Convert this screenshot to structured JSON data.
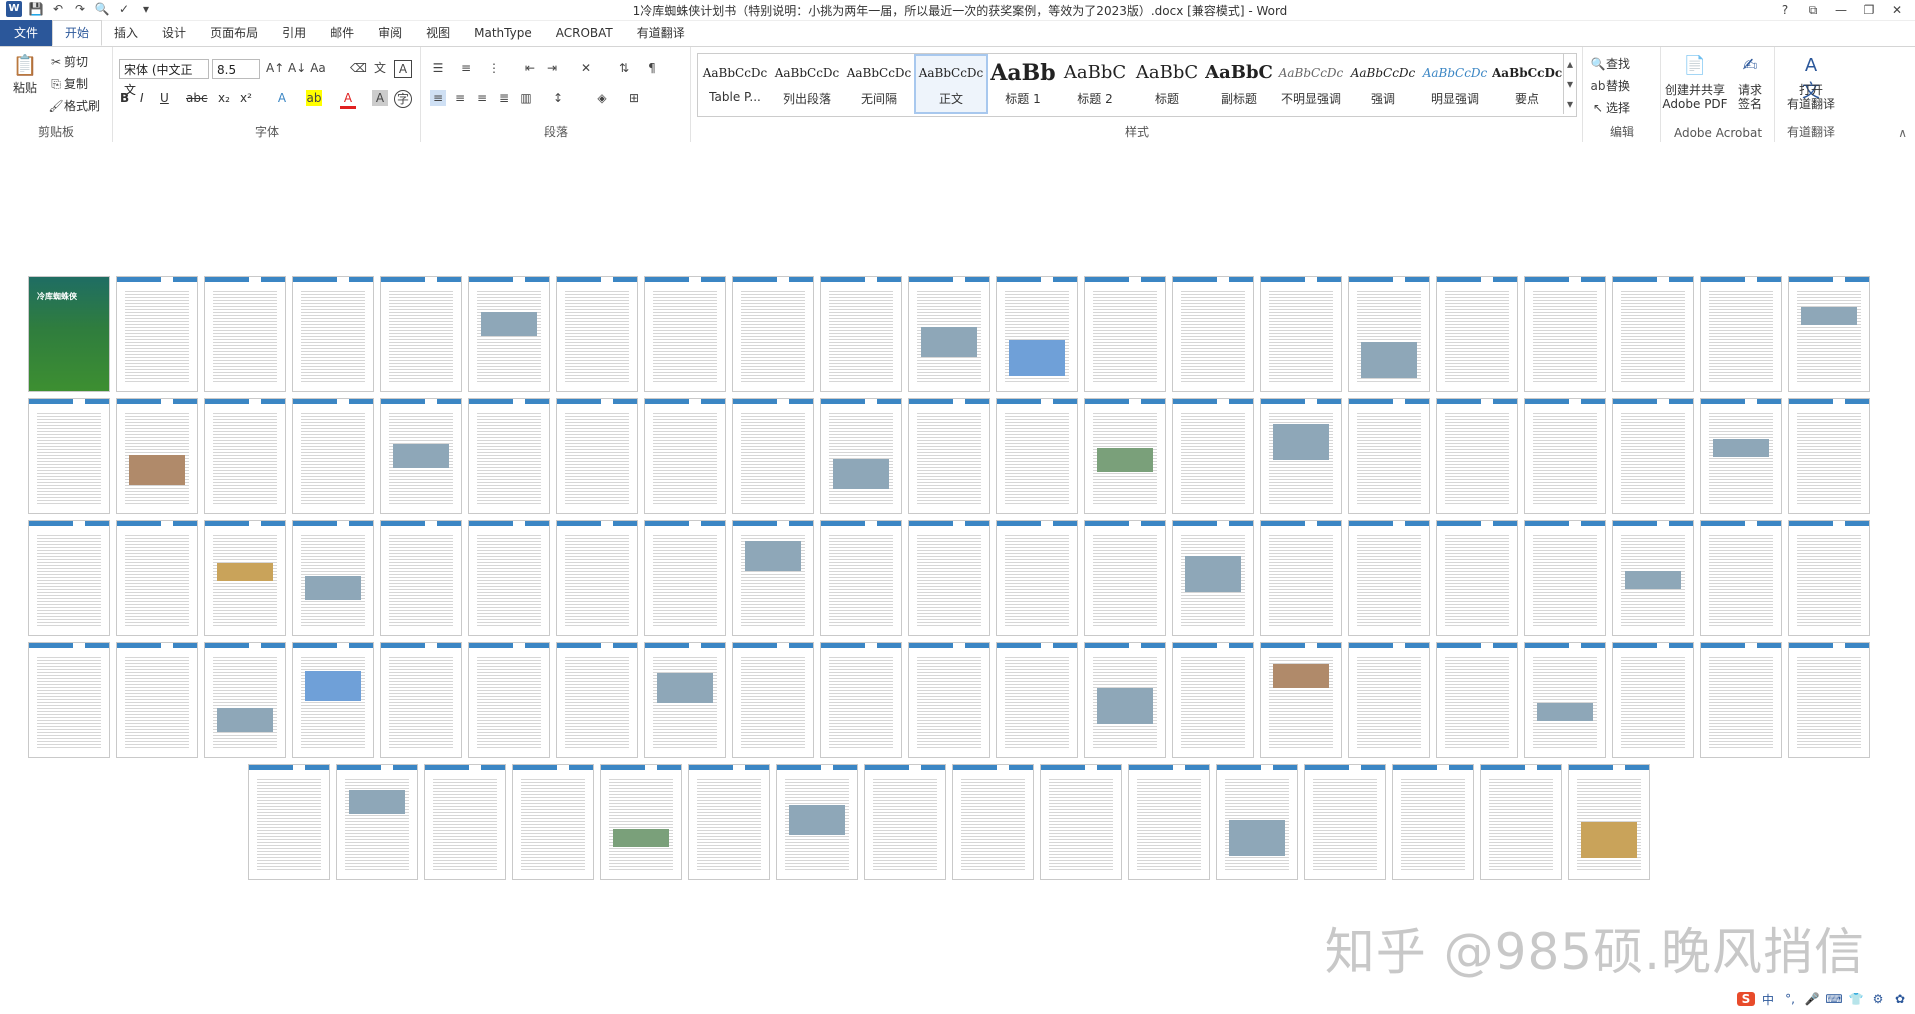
{
  "window": {
    "title": "1冷库蜘蛛侠计划书（特别说明：小挑为两年一届，所以最近一次的获奖案例，等效为了2023版）.docx [兼容模式] - Word",
    "controls": [
      "?",
      "⧉",
      "—",
      "❐",
      "✕"
    ]
  },
  "quick_access": [
    "W",
    "💾",
    "↶",
    "↷",
    "🔍",
    "✓",
    "▾"
  ],
  "tabs": [
    "文件",
    "开始",
    "插入",
    "设计",
    "页面布局",
    "引用",
    "邮件",
    "审阅",
    "视图",
    "MathType",
    "ACROBAT",
    "有道翻译"
  ],
  "active_tab": "开始",
  "clipboard": {
    "group_label": "剪贴板",
    "paste": "粘贴",
    "cut": "剪切",
    "copy": "复制",
    "format_painter": "格式刷"
  },
  "font": {
    "group_label": "字体",
    "font_name": "宋体 (中文正文",
    "font_size": "8.5",
    "row2": [
      "B",
      "I",
      "U",
      "abc",
      "x₂",
      "x²"
    ]
  },
  "paragraph": {
    "group_label": "段落"
  },
  "styles": {
    "group_label": "样式",
    "items": [
      {
        "sample": "AaBbCcDc",
        "name": "Table P..."
      },
      {
        "sample": "AaBbCcDc",
        "name": "列出段落"
      },
      {
        "sample": "AaBbCcDc",
        "name": "无间隔"
      },
      {
        "sample": "AaBbCcDc",
        "name": "正文"
      },
      {
        "sample": "AaBb",
        "name": "标题 1"
      },
      {
        "sample": "AaBbC",
        "name": "标题 2"
      },
      {
        "sample": "AaBbC",
        "name": "标题"
      },
      {
        "sample": "AaBbC",
        "name": "副标题"
      },
      {
        "sample": "AaBbCcDc",
        "name": "不明显强调"
      },
      {
        "sample": "AaBbCcDc",
        "name": "强调"
      },
      {
        "sample": "AaBbCcDc",
        "name": "明显强调"
      },
      {
        "sample": "AaBbCcDc",
        "name": "要点"
      }
    ],
    "selected_index": 3
  },
  "editing": {
    "group_label": "编辑",
    "find": "查找",
    "replace": "替换",
    "select": "选择"
  },
  "acrobat": {
    "group_label": "Adobe Acrobat",
    "create_share": "创建并共享\nAdobe PDF",
    "request_sign": "请求\n签名"
  },
  "youdao": {
    "group_label": "有道翻译",
    "open": "打开\n有道翻译"
  },
  "document": {
    "cover_title": "冷库蜘蛛侠",
    "page_rows": [
      21,
      21,
      21,
      21,
      16
    ]
  },
  "watermark": "知乎 @985硕.晚风捎信",
  "ime": [
    "S",
    "中",
    "°,",
    "🎤",
    "⌨",
    "👕",
    "⚙",
    "✿"
  ],
  "colors": {
    "accent": "#2b579a",
    "page_header": "#3b86c4"
  }
}
